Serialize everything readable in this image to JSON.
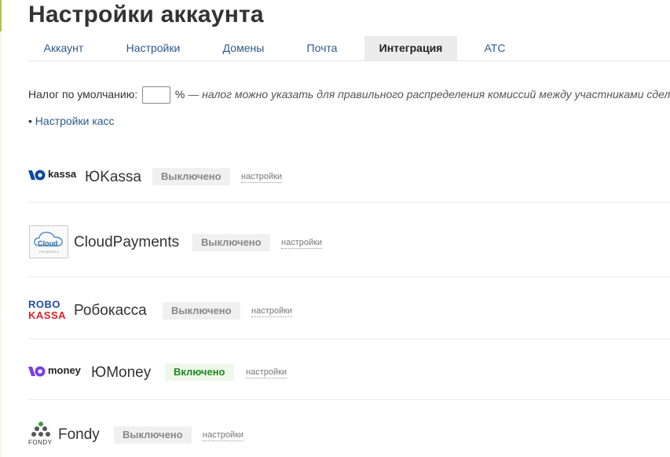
{
  "page": {
    "title": "Настройки аккаунта"
  },
  "tabs": [
    {
      "label": "Аккаунт"
    },
    {
      "label": "Настройки"
    },
    {
      "label": "Домены"
    },
    {
      "label": "Почта"
    },
    {
      "label": "Интеграция",
      "active": true
    },
    {
      "label": "АТС"
    }
  ],
  "tax": {
    "label": "Налог по умолчанию:",
    "value": "",
    "unit": "%",
    "note": "— налог можно указать для правильного распределения комиссий между участниками сделки"
  },
  "kassa": {
    "bullet": "•",
    "link_label": "Настройки касс"
  },
  "providers": [
    {
      "logo_text": "kassa",
      "name": "ЮKassa",
      "status": "Выключено",
      "enabled": false,
      "settings": "настройки"
    },
    {
      "logo_text": "Cloud",
      "logo_subtext": "PAYMENTS",
      "name": "CloudPayments",
      "status": "Выключено",
      "enabled": false,
      "settings": "настройки"
    },
    {
      "logo_text": "ROBO",
      "logo_text2": "KASSA",
      "name": "Робокасса",
      "status": "Выключено",
      "enabled": false,
      "settings": "настройки"
    },
    {
      "logo_text": "money",
      "name": "ЮMoney",
      "status": "Включено",
      "enabled": true,
      "settings": "настройки"
    },
    {
      "logo_text": "FONDY",
      "name": "Fondy",
      "status": "Выключено",
      "enabled": false,
      "settings": "настройки"
    }
  ],
  "colors": {
    "link": "#2a5a8c",
    "enabled": "#1f8a1f",
    "disabled": "#888888",
    "robo_blue": "#1d4fa3",
    "robo_red": "#d8232a",
    "yoomoney_purple": "#7b3fe4",
    "yookassa_blue": "#0d47a1"
  }
}
